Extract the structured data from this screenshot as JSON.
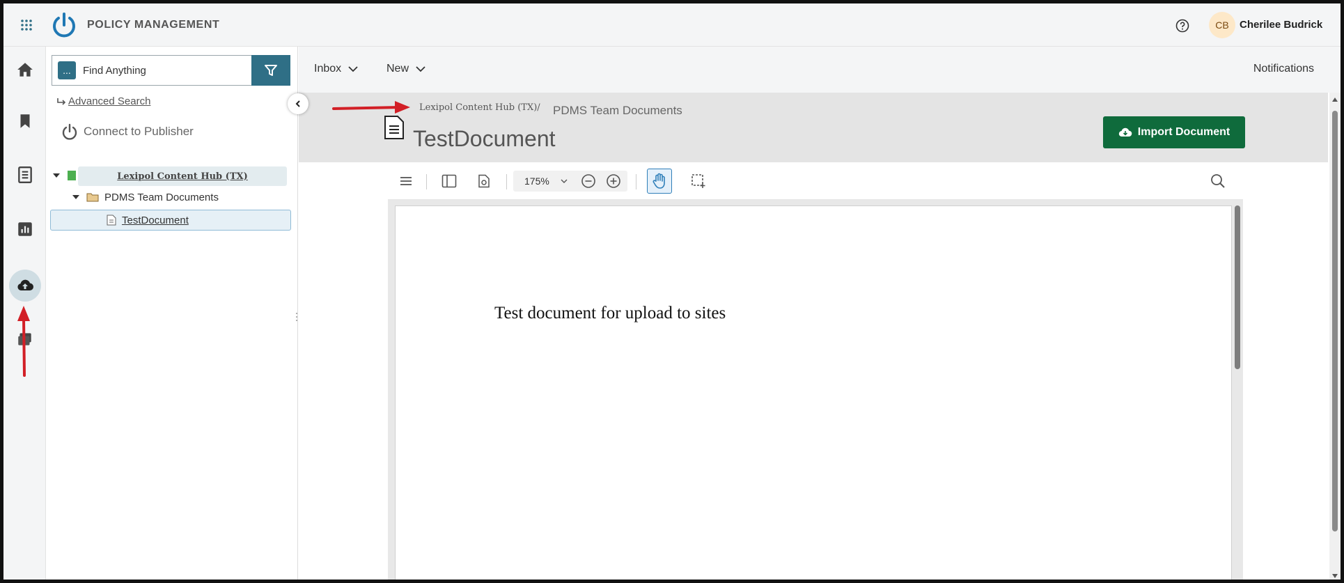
{
  "header": {
    "app_title": "POLICY MANAGEMENT",
    "user_initials": "CB",
    "user_name": "Cherilee Budrick"
  },
  "rail": {
    "items": [
      "home",
      "bookmarks",
      "documents",
      "reports",
      "upload",
      "folders"
    ],
    "active": "upload"
  },
  "sidebar": {
    "search_placeholder": "Find Anything",
    "search_scope_label": "...",
    "advanced_search": "Advanced Search",
    "connect_publisher": "Connect to Publisher",
    "tree": {
      "root_label": "Lexipol Content Hub (TX)",
      "folder_label": "PDMS Team Documents",
      "doc_label": "TestDocument"
    }
  },
  "subnav": {
    "inbox": "Inbox",
    "new": "New",
    "notifications": "Notifications"
  },
  "document": {
    "breadcrumb_root": "Lexipol Content Hub (TX)/",
    "breadcrumb_folder": "PDMS Team Documents",
    "title": "TestDocument",
    "import_button": "Import Document"
  },
  "viewer": {
    "zoom": "175%",
    "page_text": "Test document for upload to sites"
  },
  "colors": {
    "accent": "#2f6f86",
    "import_button": "#0f6b3c",
    "annotation": "#d21f26"
  }
}
